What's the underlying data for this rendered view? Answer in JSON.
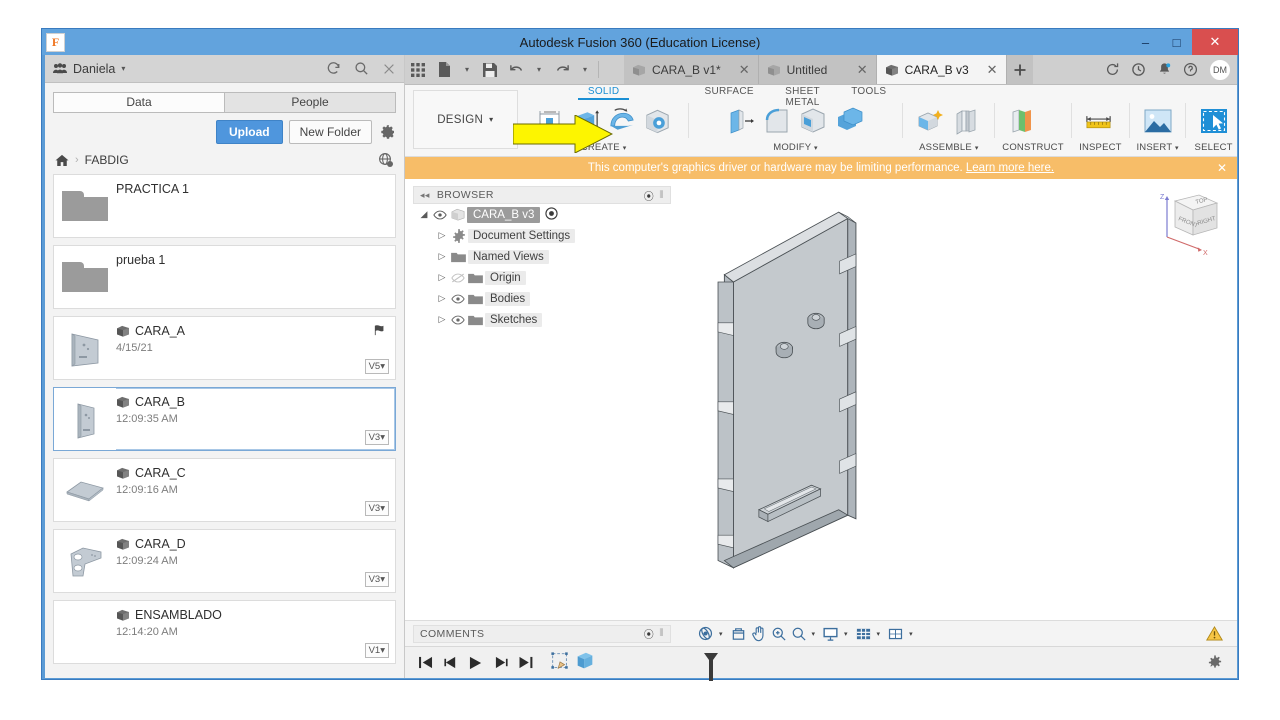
{
  "window": {
    "title": "Autodesk Fusion 360 (Education License)",
    "logo_letter": "F",
    "minimize": "–",
    "maximize": "□",
    "close": "✕"
  },
  "data_panel": {
    "user_name": "Daniela",
    "user_caret": "▾",
    "icons": {
      "people": "people-icon",
      "refresh": "refresh-icon",
      "search": "search-icon",
      "close": "close-icon",
      "gear": "gear-icon",
      "home": "home-icon",
      "share": "share-globe-icon"
    },
    "tabs": [
      {
        "label": "Data",
        "active": true
      },
      {
        "label": "People",
        "active": false
      }
    ],
    "upload_label": "Upload",
    "new_folder_label": "New Folder",
    "breadcrumb": {
      "separator": "›",
      "current": "FABDIG"
    },
    "items": [
      {
        "name": "PRACTICA 1",
        "date": "",
        "version": "",
        "type": "folder",
        "selected": false,
        "flag": false
      },
      {
        "name": "prueba 1",
        "date": "",
        "version": "",
        "type": "folder",
        "selected": false,
        "flag": false
      },
      {
        "name": "CARA_A",
        "date": "4/15/21",
        "version": "V5",
        "type": "design",
        "selected": false,
        "flag": true
      },
      {
        "name": "CARA_B",
        "date": "12:09:35 AM",
        "version": "V3",
        "type": "design",
        "selected": true,
        "flag": false
      },
      {
        "name": "CARA_C",
        "date": "12:09:16 AM",
        "version": "V3",
        "type": "design",
        "selected": false,
        "flag": false
      },
      {
        "name": "CARA_D",
        "date": "12:09:24 AM",
        "version": "V3",
        "type": "design",
        "selected": false,
        "flag": false
      },
      {
        "name": "ENSAMBLADO",
        "date": "12:14:20 AM",
        "version": "V1",
        "type": "design",
        "selected": false,
        "flag": false
      }
    ],
    "version_caret": "▾"
  },
  "tab_strip": {
    "icons": {
      "grid": "app-grid-icon",
      "file": "new-file-icon",
      "save": "save-icon",
      "undo": "undo-icon",
      "redo": "redo-icon",
      "plus": "new-tab-icon",
      "help_ring": "refresh-job-icon",
      "history": "job-status-icon",
      "notification": "notification-bell-icon",
      "help": "help-icon"
    },
    "caret": "▾",
    "close_glyph": "✕",
    "documents": [
      {
        "label": "CARA_B v1*",
        "active": false
      },
      {
        "label": "Untitled",
        "active": false
      },
      {
        "label": "CARA_B v3",
        "active": true
      }
    ],
    "avatar_initials": "DM"
  },
  "ribbon": {
    "workspace": "DESIGN",
    "workspace_caret": "▾",
    "tabs": [
      {
        "label": "SOLID",
        "active": true
      },
      {
        "label": "SURFACE",
        "active": false
      },
      {
        "label": "SHEET METAL",
        "active": false
      },
      {
        "label": "TOOLS",
        "active": false
      }
    ],
    "groups": [
      {
        "label": "CREATE",
        "caret": "▾"
      },
      {
        "label": "MODIFY",
        "caret": "▾"
      },
      {
        "label": "ASSEMBLE",
        "caret": "▾"
      },
      {
        "label": "CONSTRUCT",
        "caret": "▾"
      },
      {
        "label": "INSPECT",
        "caret": "▾"
      },
      {
        "label": "INSERT",
        "caret": "▾"
      },
      {
        "label": "SELECT",
        "caret": "▾"
      }
    ],
    "annotation": "yellow-arrow-pointing-at-extrude"
  },
  "banner": {
    "message": "This computer's graphics driver or hardware may be limiting performance.",
    "link": "Learn more here.",
    "close": "✕",
    "color": "#f7bd68"
  },
  "browser": {
    "title": "BROWSER",
    "collapse": "◂◂",
    "dot": "⦿",
    "grip": "⦀",
    "root": {
      "label": "CARA_B v3",
      "expand": "◢"
    },
    "nodes": [
      {
        "label": "Document Settings",
        "arrow": "▷",
        "icon": "gear-icon",
        "eye": false
      },
      {
        "label": "Named Views",
        "arrow": "▷",
        "icon": "folder-icon",
        "eye": false
      },
      {
        "label": "Origin",
        "arrow": "▷",
        "icon": "folder-icon",
        "eye": true,
        "eye_off": true
      },
      {
        "label": "Bodies",
        "arrow": "▷",
        "icon": "folder-icon",
        "eye": true,
        "eye_off": false
      },
      {
        "label": "Sketches",
        "arrow": "▷",
        "icon": "folder-icon",
        "eye": true,
        "eye_off": false
      }
    ]
  },
  "viewcube": {
    "faces": {
      "top": "TOP",
      "front": "FRONT",
      "right": "RIGHT"
    },
    "axis_z": "Z",
    "axis_x": "X"
  },
  "model": {
    "description": "Isometric grey sheet-metal panel with edge notches, two cylindrical bosses and a rectangular slot",
    "face_color": "#c4c9cd",
    "edge_color": "#4a5054"
  },
  "comments": {
    "title": "COMMENTS",
    "dot": "⦿",
    "grip": "⦀"
  },
  "nav_bar": {
    "tools": [
      {
        "name": "orbit-icon",
        "caret": "▾"
      },
      {
        "name": "look-at-icon",
        "caret": ""
      },
      {
        "name": "pan-icon",
        "caret": ""
      },
      {
        "name": "zoom-icon",
        "caret": ""
      },
      {
        "name": "zoom-window-icon",
        "caret": "▾"
      },
      {
        "name": "display-settings-icon",
        "caret": "▾"
      },
      {
        "name": "grid-snap-icon",
        "caret": "▾"
      },
      {
        "name": "viewports-icon",
        "caret": "▾"
      }
    ],
    "warning": "warning-triangle-icon"
  },
  "timeline": {
    "controls": [
      "go-to-beginning",
      "step-back",
      "play",
      "step-forward",
      "go-to-end"
    ],
    "features": [
      "sketch-feature-icon",
      "extrude-feature-icon"
    ],
    "marker": "timeline-marker",
    "settings": "settings-gear-icon"
  }
}
